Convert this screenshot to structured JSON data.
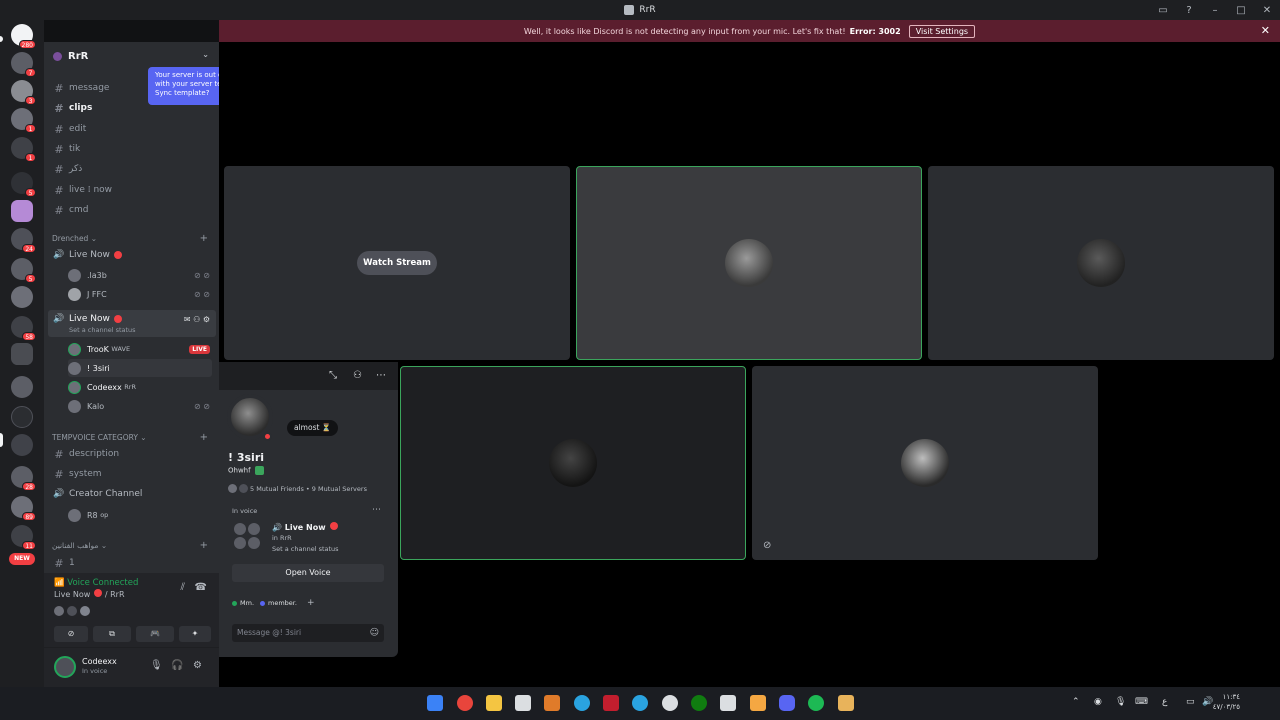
{
  "window": {
    "title": "RrR"
  },
  "notice": {
    "text": "Well, it looks like Discord is not detecting any input from your mic. Let's fix that!",
    "error": "Error: 3002",
    "button": "Visit Settings"
  },
  "guild_badges": [
    "280",
    "7",
    "3",
    "1",
    "1",
    "5",
    "24",
    "5",
    "58",
    "28",
    "89",
    "11",
    "NEW"
  ],
  "server": {
    "name": "RrR"
  },
  "tooltip": "Your server is out of sync with your server template. Sync template?",
  "text_channels": [
    "message",
    "clips",
    "edit",
    "tik",
    "ذكر",
    "live ⁞ now",
    "cmd"
  ],
  "categories": {
    "drenched": "Drenched",
    "tempvoice": "TEMPVOICE CATEGORY",
    "arabic": "مواهب الفنانين"
  },
  "voice1": {
    "name": "Live Now",
    "users": [
      ".la3b",
      "J"
    ],
    "user2_tag": "FFC"
  },
  "voice2": {
    "name": "Live Now",
    "status": "Set a channel status",
    "live": "LIVE",
    "users": [
      {
        "name": "TrooK",
        "tag": "WAVE"
      },
      {
        "name": "! 3siri",
        "tag": ""
      },
      {
        "name": "Codeexx",
        "tag": "RrR"
      },
      {
        "name": "Kalo",
        "tag": ""
      }
    ]
  },
  "temp_channels": [
    "description",
    "system",
    "Creator Channel"
  ],
  "temp_user": {
    "name": "R8",
    "tag": "op"
  },
  "arabic_channel": "1",
  "voice_panel": {
    "status": "Voice Connected",
    "channel": "Live Now",
    "server": "/ RrR"
  },
  "user_panel": {
    "name": "Codeexx",
    "status": "In voice"
  },
  "stage": {
    "watch": "Watch Stream"
  },
  "profile": {
    "bubble": "almost ⏳",
    "name": "! 3siri",
    "tag": "Ohwhf",
    "mutual_friends": "5 Mutual Friends",
    "mutual_servers": "9 Mutual Servers",
    "in_voice": "In voice",
    "voice_name": "Live Now",
    "voice_in": "in RrR",
    "voice_status": "Set a channel status",
    "open": "Open Voice",
    "roles": [
      "Mm.",
      "member."
    ],
    "message_placeholder": "Message @! 3siri"
  },
  "clock": {
    "time": "١١:٣٤",
    "date": "٤٧/٠٣/٢٥"
  },
  "colors": {
    "accent": "#5865f2",
    "speaking": "#3ba55c",
    "danger": "#f23f43",
    "notice": "#5b1e2e"
  }
}
